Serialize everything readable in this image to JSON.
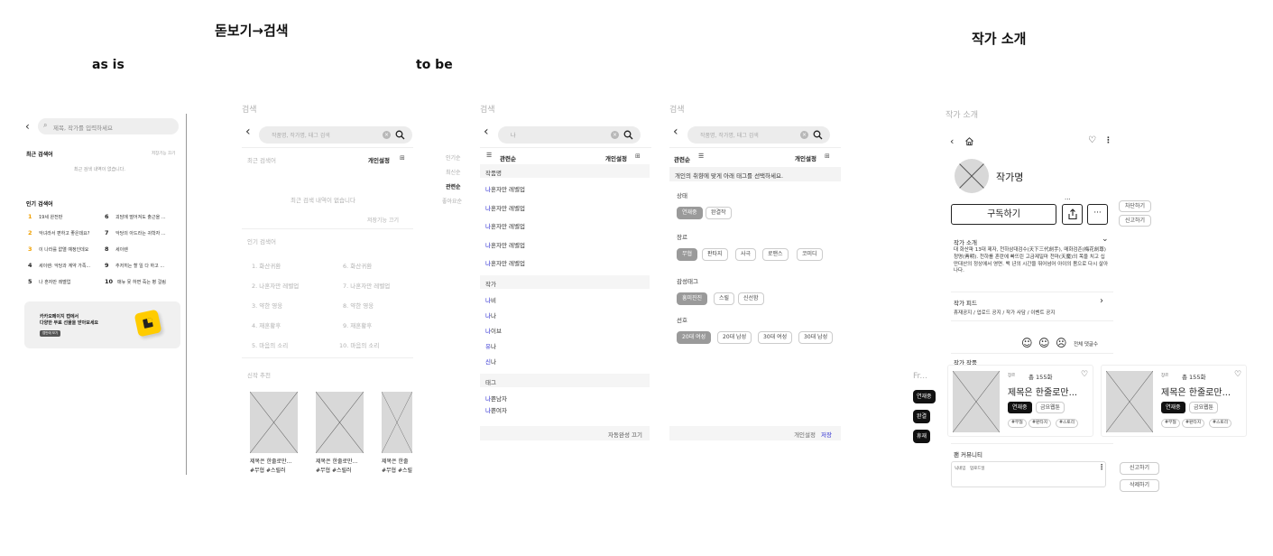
{
  "headers": {
    "as_is": "as is",
    "dotbogi_search": "돋보기→검색",
    "to_be": "to be",
    "author_intro": "작가 소개"
  },
  "panel_a": {
    "search_placeholder": "제목, 작가를 입력하세요",
    "recent_label": "최근 검색어",
    "recent_action": "저장기능 끄기",
    "recent_empty": "최근 검색 내역이 없습니다.",
    "popular_label": "인기 검색어",
    "popular": [
      {
        "rank": "1",
        "text": "19세 완전판"
      },
      {
        "rank": "2",
        "text": "악녀라서 편하고 좋은데요?"
      },
      {
        "rank": "3",
        "text": "이 나라를 없앨 예정인데요"
      },
      {
        "rank": "4",
        "text": "세이렌: 악당과 계약 가족..."
      },
      {
        "rank": "5",
        "text": "나 혼자만 레벨업"
      },
      {
        "rank": "6",
        "text": "괴담에 떨어져도 출근을 ..."
      },
      {
        "rank": "7",
        "text": "악당의 아드라는 귀학자 ..."
      },
      {
        "rank": "8",
        "text": "세이렌"
      },
      {
        "rank": "9",
        "text": "추저히는 할 일 다 하고 ..."
      },
      {
        "rank": "10",
        "text": "매뉴 못 하면 죽는 병 걸림"
      }
    ],
    "banner_line1": "카카오페이지 캡에서",
    "banner_line2": "다양한 무료 선물을 받아보세요",
    "banner_button": "캡만에 보기"
  },
  "panel_b": {
    "screen_label": "검색",
    "search_placeholder": "작품명, 작가명, 태그 검색",
    "recent_label": "최근 검색어",
    "personal_settings": "개인설정",
    "recent_empty": "최근 검색 내역이 없습니다",
    "save_off": "저장기능 끄기",
    "popular_label": "인기 검색어",
    "popular_left": [
      "1. 화산귀환",
      "2. 나혼자만 레벨업",
      "3. 약한 영웅",
      "4. 재혼황후",
      "5. 마음의 소리"
    ],
    "popular_right": [
      "6. 화산귀환",
      "7. 나혼자만 레벨업",
      "8. 약한 영웅",
      "9. 재혼황후",
      "10. 마음의 소리"
    ],
    "new_label": "신작 추천",
    "cards": [
      {
        "title": "제목은 한줄로만...",
        "tags": "#무협 #스릴러"
      },
      {
        "title": "제목은 한줄로만...",
        "tags": "#무협 #스릴러"
      },
      {
        "title": "제목은 한줄",
        "tags": "#무협 #스릴"
      }
    ]
  },
  "panel_c": {
    "screen_label": "검색",
    "query": "나",
    "sort_options": [
      "인기순",
      "최신순",
      "관련순",
      "좋아요순"
    ],
    "sort_selected": "관련순",
    "personal_settings": "개인설정",
    "works_label": "작품명",
    "works": [
      "나혼자만 레벨업",
      "나혼자만 레벨업",
      "나혼자만 레벨업",
      "나혼자만 레벨업",
      "나혼자만 레벨업"
    ],
    "authors_label": "작가",
    "authors": [
      "나비",
      "나나",
      "나이브",
      "유나",
      "신나"
    ],
    "tags_label": "태그",
    "tags": [
      "나쁜남자",
      "나쁜여자"
    ],
    "autocomplete_off": "자동완성 끄기"
  },
  "panel_d": {
    "screen_label": "검색",
    "search_placeholder": "작품명, 작가명, 태그 검색",
    "sort_label": "관련순",
    "personal_settings": "개인설정",
    "instruction": "개인의 취향에 맞게 아래 태그를 선택하세요.",
    "status_label": "상태",
    "status_tags": [
      "연재중",
      "완결작"
    ],
    "genre_label": "장르",
    "genre_tags": [
      "무협",
      "판타지",
      "사극",
      "로맨스",
      "코미디"
    ],
    "emotion_label": "감성태그",
    "emotion_tags": [
      "흥미진진",
      "스릴",
      "신선함"
    ],
    "pref_label": "선호",
    "pref_tags": [
      "20대 여성",
      "20대 남성",
      "30대 여성",
      "30대 남성"
    ],
    "footer_text": "개인설정",
    "footer_save": "저장"
  },
  "panel_e": {
    "screen_label": "작가 소개",
    "author_name": "작가명",
    "subscribe": "구독하기",
    "more_dots": "...",
    "side_block": "차단하기",
    "side_report": "신고하기",
    "intro_label": "작가 소개",
    "intro_text": "대 화산파 13대 제자, 천하삼대검수(天下三代劍手), 매화검존(梅花劍尊) 청명(靑明). 천하를 혼란에 빠뜨린 고금제일마 천마(天魔)의 목을 치고 십만대산의 정상에서 영면. 백 년의 시간을 뛰어넘어 아이의 몸으로 다시 살아나다.",
    "feed_label": "작가 피드",
    "feed_text": "휴재공지 / 업로드 공지 / 작가 사담 / 이벤트 공지",
    "reactions_label": "전체 댓글수",
    "works_label": "작가 작품",
    "filter_label": "Fr...",
    "filters": [
      "연재중",
      "완결",
      "휴재"
    ],
    "works": [
      {
        "genre": "장르",
        "count": "총 155화",
        "title": "제목은 한줄로만...",
        "status": "연재중",
        "day": "금요웹툰",
        "tags": [
          "#무협",
          "#판타지",
          "#스토리"
        ]
      },
      {
        "genre": "장르",
        "count": "총 155화",
        "title": "제목은 한줄로만...",
        "status": "연재중",
        "day": "금요웹툰",
        "tags": [
          "#무협",
          "#판타지",
          "#스토리"
        ]
      }
    ],
    "fan_label": "팬 커뮤니티",
    "fan_user": "닉네임",
    "fan_date": "업로드일",
    "fan_report": "신고하기",
    "fan_delete": "삭제하기"
  }
}
